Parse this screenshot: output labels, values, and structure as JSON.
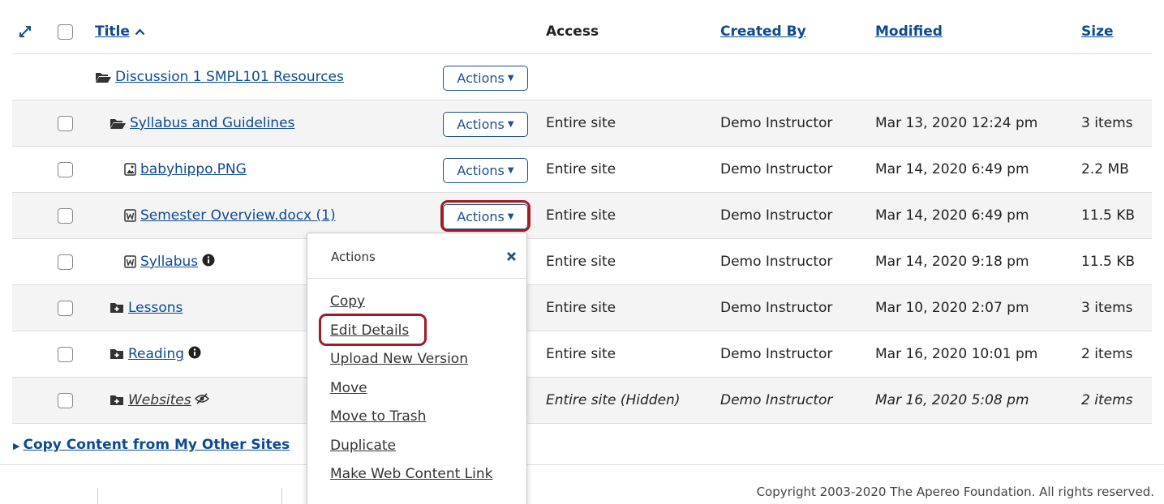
{
  "header": {
    "title": "Title",
    "title_sort_icon": "sort-ascending-icon",
    "expand_icon": "expand-all-icon",
    "access": "Access",
    "created_by": "Created By",
    "modified": "Modified",
    "size": "Size"
  },
  "actions_label": "Actions",
  "rows": [
    {
      "icon": "folder-open-icon",
      "title": "Discussion 1 SMPL101 Resources",
      "access": "",
      "created_by": "",
      "modified": "",
      "size": ""
    },
    {
      "icon": "folder-open-icon",
      "title": "Syllabus and Guidelines",
      "access": "Entire site",
      "created_by": "Demo Instructor",
      "modified": "Mar 13, 2020 12:24 pm",
      "size": "3 items"
    },
    {
      "icon": "image-file-icon",
      "title": "babyhippo.PNG",
      "access": "Entire site",
      "created_by": "Demo Instructor",
      "modified": "Mar 14, 2020 6:49 pm",
      "size": "2.2 MB"
    },
    {
      "icon": "word-file-icon",
      "title": "Semester Overview.docx (1)",
      "access": "Entire site",
      "created_by": "Demo Instructor",
      "modified": "Mar 14, 2020 6:49 pm",
      "size": "11.5 KB"
    },
    {
      "icon": "word-file-icon",
      "title": "Syllabus",
      "access": "Entire site",
      "created_by": "Demo Instructor",
      "modified": "Mar 14, 2020 9:18 pm",
      "size": "11.5 KB"
    },
    {
      "icon": "folder-plus-icon",
      "title": "Lessons",
      "access": "Entire site",
      "created_by": "Demo Instructor",
      "modified": "Mar 10, 2020 2:07 pm",
      "size": "3 items"
    },
    {
      "icon": "folder-plus-icon",
      "title": "Reading",
      "access": "Entire site",
      "created_by": "Demo Instructor",
      "modified": "Mar 16, 2020 10:01 pm",
      "size": "2 items"
    },
    {
      "icon": "folder-plus-icon",
      "title": "Websites",
      "access": "Entire site (Hidden)",
      "created_by": "Demo Instructor",
      "modified": "Mar 16, 2020 5:08 pm",
      "size": "2 items"
    }
  ],
  "popup": {
    "title": "Actions",
    "close_icon": "close-icon",
    "items": [
      "Copy",
      "Edit Details",
      "Upload New Version",
      "Move",
      "Move to Trash",
      "Duplicate",
      "Make Web Content Link"
    ]
  },
  "copy_content_link": "Copy Content from My Other Sites",
  "footer": {
    "copyright": "Copyright 2003-2020 The Apereo Foundation. All rights reserved."
  },
  "colors": {
    "link": "#0d4a90",
    "highlight": "#a01c24",
    "button_border": "#1f4f8b"
  }
}
